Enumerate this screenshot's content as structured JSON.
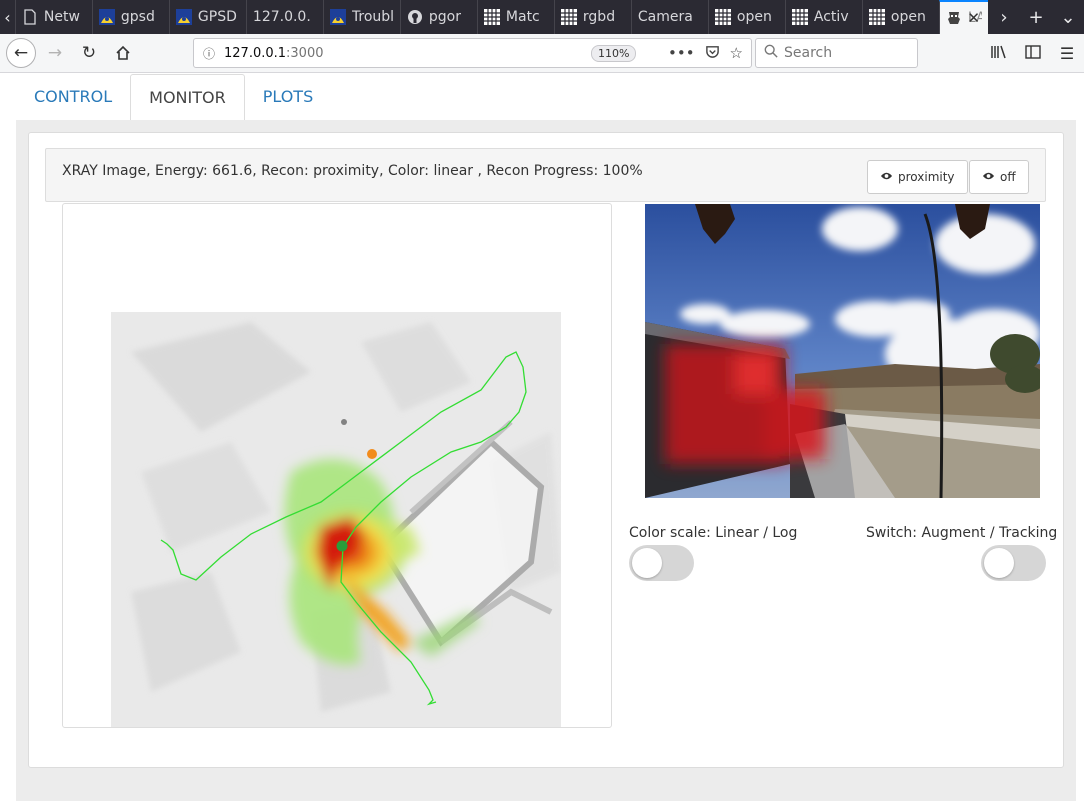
{
  "browser": {
    "tabs": [
      {
        "title": "Netw",
        "icon": "document-icon"
      },
      {
        "title": "gpsd",
        "icon": "satellite-icon"
      },
      {
        "title": "GPSD",
        "icon": "satellite-icon"
      },
      {
        "title": "127.0.0.",
        "icon": "none"
      },
      {
        "title": "Troubl",
        "icon": "satellite-icon"
      },
      {
        "title": "pgor",
        "icon": "github-icon"
      },
      {
        "title": "Matc",
        "icon": "grid-icon"
      },
      {
        "title": "rgbd",
        "icon": "grid-icon"
      },
      {
        "title": "Camera",
        "icon": "none"
      },
      {
        "title": "open",
        "icon": "grid-icon"
      },
      {
        "title": "Activ",
        "icon": "grid-icon"
      },
      {
        "title": "open",
        "icon": "grid-icon"
      }
    ],
    "active_tab": {
      "title": "LA",
      "icon": "robot-icon"
    },
    "url_host": "127.0.0.1",
    "url_port": ":3000",
    "zoom": "110%",
    "search_placeholder": "Search"
  },
  "app": {
    "tabs": [
      {
        "label": "CONTROL",
        "active": false
      },
      {
        "label": "MONITOR",
        "active": true
      },
      {
        "label": "PLOTS",
        "active": false
      }
    ],
    "header_text": "XRAY Image, Energy: 661.6, Recon: proximity, Color: linear , Recon Progress: 100%",
    "recon_button": "proximity",
    "view_button": "off",
    "color_scale_label": "Color scale: Linear / Log",
    "switch_label": "Switch: Augment / Tracking",
    "color_scale_on": false,
    "switch_on": false,
    "colors": {
      "accent": "#2a7ab9",
      "trajectory": "#33dd33",
      "start_marker": "#f28c1c",
      "current_marker": "#2a9d3a"
    }
  }
}
